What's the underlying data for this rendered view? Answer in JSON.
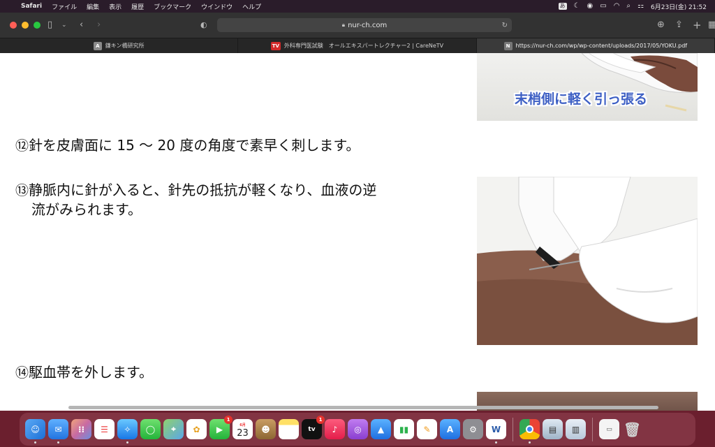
{
  "menubar": {
    "app_name": "Safari",
    "items": [
      "ファイル",
      "編集",
      "表示",
      "履歴",
      "ブックマーク",
      "ウインドウ",
      "ヘルプ"
    ],
    "ime": "あ",
    "datetime": "6月23日(金)  21:52"
  },
  "browser": {
    "address": "nur-ch.com",
    "tabs": [
      {
        "icon": "A",
        "label": "鎌キン橋研究所"
      },
      {
        "icon": "TV",
        "label": "外科専門医試験　オールエキスパートレクチャー2 | CareNeTV"
      },
      {
        "icon": "N",
        "label": "https://nur-ch.com/wp/wp-content/uploads/2017/05/YOKU.pdf"
      }
    ]
  },
  "document": {
    "step12": {
      "num": "⑫",
      "text": "針を皮膚面に 15 〜 20 度の角度で素早く刺します。"
    },
    "step13": {
      "num": "⑬",
      "line1": "静脈内に針が入ると、針先の抵抗が軽くなり、血液の逆",
      "line2": "流がみられます。"
    },
    "step14": {
      "num": "⑭",
      "text": "駆血帯を外します。"
    },
    "photo_caption": "末梢側に軽く引っ張る"
  },
  "dock": {
    "calendar_day": "23",
    "calendar_month": "6月",
    "badges": {
      "facetime": "1",
      "tv": "1"
    }
  },
  "colors": {
    "menubar_bg": "#2a1c2a",
    "toolbar_bg": "#323232",
    "caption_blue": "#3d5fc4",
    "dock_bg": "#964655"
  }
}
